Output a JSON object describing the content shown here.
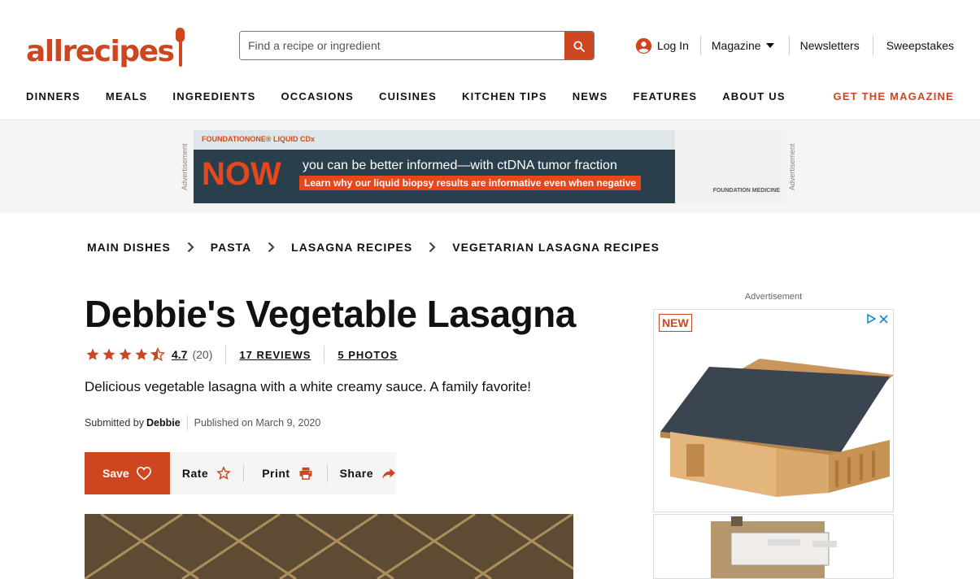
{
  "brand": {
    "logo_text": "allrecipes",
    "accent_color": "#ce4620"
  },
  "search": {
    "placeholder": "Find a recipe or ingredient"
  },
  "user_nav": {
    "login": "Log In",
    "magazine": "Magazine",
    "newsletters": "Newsletters",
    "sweepstakes": "Sweepstakes"
  },
  "nav": {
    "items": [
      "DINNERS",
      "MEALS",
      "INGREDIENTS",
      "OCCASIONS",
      "CUISINES",
      "KITCHEN TIPS",
      "NEWS",
      "FEATURES",
      "ABOUT US"
    ],
    "cta": "GET THE MAGAZINE"
  },
  "top_ad": {
    "label": "Advertisement",
    "brand": "FOUNDATIONONE® LIQUID CDx",
    "headline": "NOW",
    "line1": "you can be better informed—with ctDNA tumor fraction",
    "line2": "Learn why our liquid biopsy results are informative even when negative",
    "sponsor": "FOUNDATION MEDICINE"
  },
  "breadcrumbs": [
    "MAIN DISHES",
    "PASTA",
    "LASAGNA RECIPES",
    "VEGETARIAN LASAGNA RECIPES"
  ],
  "recipe": {
    "title": "Debbie's Vegetable Lasagna",
    "rating": "4.7",
    "rating_count": "(20)",
    "rating_value": 4.7,
    "reviews": "17 REVIEWS",
    "photos": "5 PHOTOS",
    "description": "Delicious vegetable lasagna with a white creamy sauce. A family favorite!",
    "submitted_by_label": "Submitted by",
    "author": "Debbie",
    "published": "Published on March 9, 2020"
  },
  "actions": {
    "save": "Save",
    "rate": "Rate",
    "print": "Print",
    "share": "Share"
  },
  "side_ad": {
    "label": "Advertisement",
    "badge": "NEW"
  }
}
